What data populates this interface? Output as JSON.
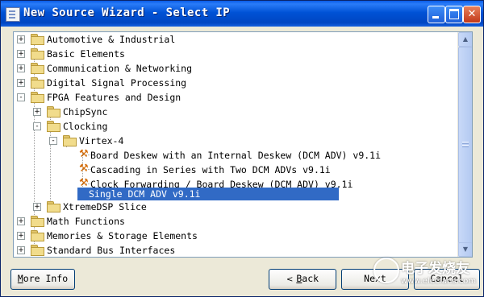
{
  "window": {
    "title": "New Source Wizard - Select IP"
  },
  "tree": {
    "items": [
      {
        "label": "Automotive & Industrial",
        "expander": "+",
        "icon": "folder-icon"
      },
      {
        "label": "Basic Elements",
        "expander": "+",
        "icon": "folder-icon"
      },
      {
        "label": "Communication & Networking",
        "expander": "+",
        "icon": "folder-icon"
      },
      {
        "label": "Digital Signal Processing",
        "expander": "+",
        "icon": "folder-icon"
      },
      {
        "label": "FPGA Features and Design",
        "expander": "-",
        "icon": "folder-icon"
      },
      {
        "label": "ChipSync",
        "expander": "+",
        "icon": "folder-icon"
      },
      {
        "label": "Clocking",
        "expander": "-",
        "icon": "folder-icon"
      },
      {
        "label": "Virtex-4",
        "expander": "-",
        "icon": "folder-icon"
      },
      {
        "label": "Board Deskew with an Internal Deskew (DCM ADV) v9.1i",
        "icon": "ip-core-icon"
      },
      {
        "label": "Cascading in Series with Two DCM ADVs v9.1i",
        "icon": "ip-core-icon"
      },
      {
        "label": "Clock Forwarding / Board Deskew (DCM ADV) v9.1i",
        "icon": "ip-core-icon"
      },
      {
        "label": "Single DCM ADV v9.1i",
        "icon": "ip-core-icon",
        "selected": true
      },
      {
        "label": "XtremeDSP Slice",
        "expander": "+",
        "icon": "folder-icon"
      },
      {
        "label": "Math Functions",
        "expander": "+",
        "icon": "folder-icon"
      },
      {
        "label": "Memories & Storage Elements",
        "expander": "+",
        "icon": "folder-icon"
      },
      {
        "label": "Standard Bus Interfaces",
        "expander": "+",
        "icon": "folder-icon"
      }
    ]
  },
  "buttons": {
    "more_info": {
      "label": "More Info",
      "underline": "M",
      "rest": "ore Info"
    },
    "back": {
      "label": "< Back",
      "arrow": "<",
      "underline": "B",
      "rest": "ack"
    },
    "next": {
      "label": "Next"
    },
    "cancel": {
      "label": "Cancel"
    }
  },
  "watermark": {
    "text": "电子发烧友",
    "url": "www.elecfans.com"
  },
  "colors": {
    "selection": "#316ac5",
    "titlebar": "#0052d6"
  }
}
